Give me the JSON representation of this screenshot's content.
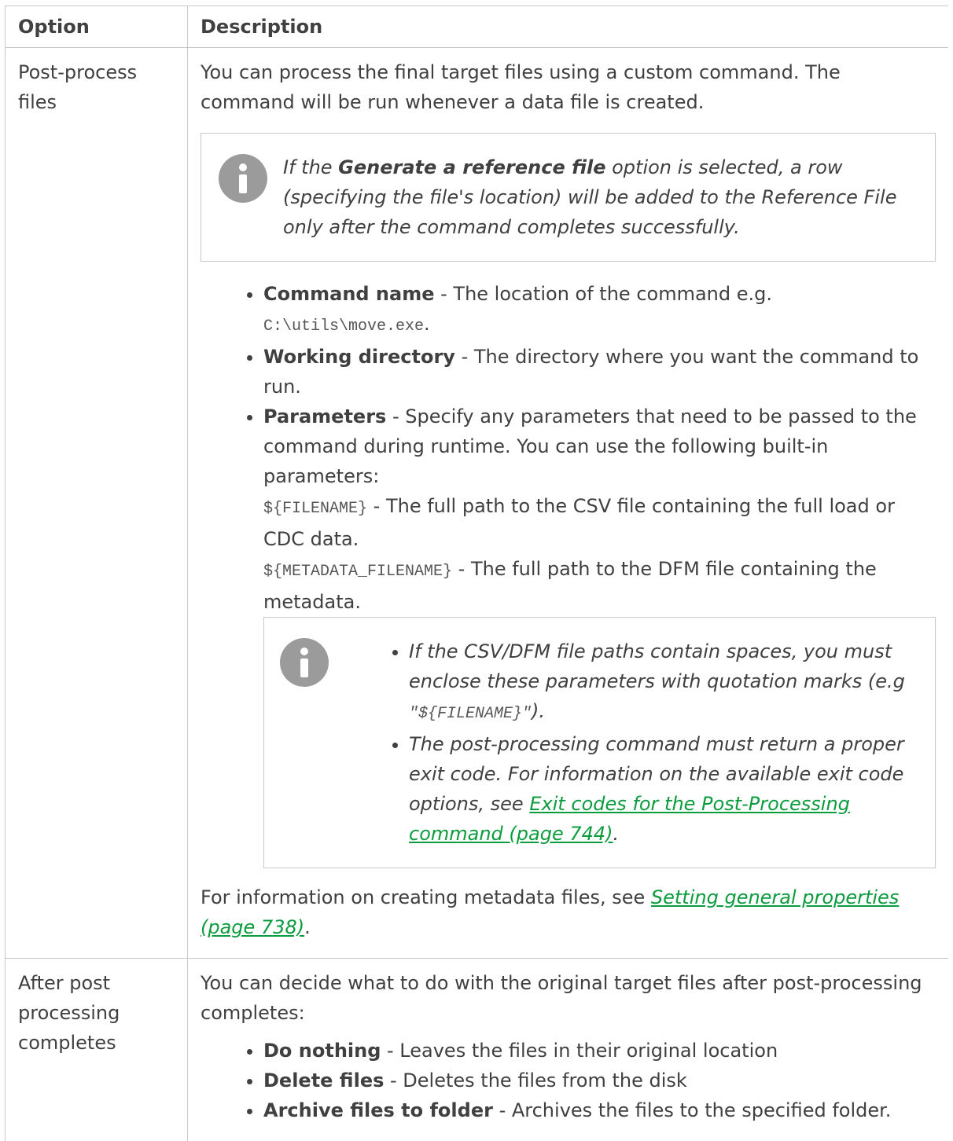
{
  "table": {
    "headers": {
      "option": "Option",
      "description": "Description"
    },
    "row1": {
      "option": "Post-process files",
      "intro": "You can process the final target files using a custom command. The command will be run whenever a data file is created.",
      "note1": {
        "pre": "If the ",
        "bold": "Generate a reference file",
        "post": " option is selected, a row (specifying the file's location) will be added to the Reference File only after the command completes successfully."
      },
      "bullets": [
        {
          "bold": "Command name",
          "text": " - The location of the command e.g.",
          "code": "C:\\utils\\move.exe",
          "after": "."
        },
        {
          "bold": "Working directory",
          "text": " - The directory where you want the command to run."
        },
        {
          "bold": "Parameters",
          "text": " - Specify any parameters that need to be passed to the command during runtime. You can use the following built-in parameters:",
          "param1_code": "${FILENAME}",
          "param1_text": " - The full path to the CSV file containing the full load or CDC data.",
          "param2_code": "${METADATA_FILENAME}",
          "param2_text": " - The full path to the DFM file containing the metadata."
        }
      ],
      "note2": {
        "item1_pre": "If the CSV/DFM file paths contain spaces, you must enclose these parameters with quotation marks (e.g ",
        "item1_code": "\"${FILENAME}\"",
        "item1_post": ").",
        "item2_pre": "The post-processing command must return a proper exit code. For information on the available exit code options, see ",
        "item2_link": " Exit codes for the Post-Processing command (page 744)",
        "item2_post": "."
      },
      "footer_pre": "For information on creating metadata files, see ",
      "footer_link": "Setting general properties (page 738)",
      "footer_post": "."
    },
    "row2": {
      "option": "After post processing completes",
      "intro": "You can decide what to do with the original target files after post-processing completes:",
      "bullets": [
        {
          "bold": "Do nothing",
          "text": " - Leaves the files in their original location"
        },
        {
          "bold": "Delete files",
          "text": " - Deletes the files from the disk"
        },
        {
          "bold": "Archive files to folder",
          "text": " - Archives the files to the specified folder."
        }
      ]
    }
  }
}
